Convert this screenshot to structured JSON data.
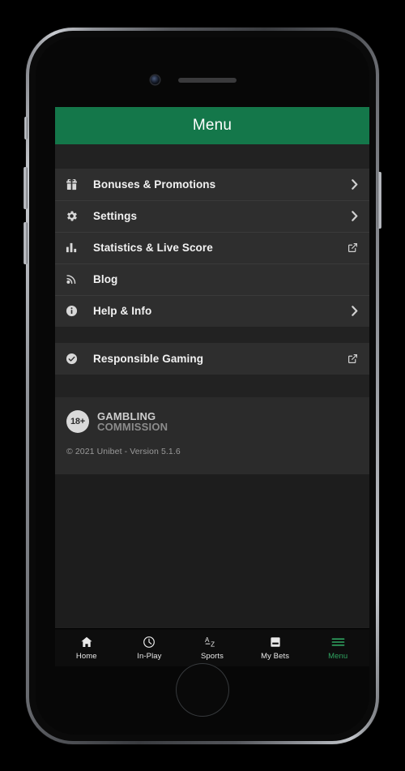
{
  "app": {
    "header_title": "Menu"
  },
  "menu": {
    "groups": [
      {
        "items": [
          {
            "label": "Bonuses & Promotions",
            "icon": "gift-icon",
            "affordance": "chevron-right-icon"
          },
          {
            "label": "Settings",
            "icon": "gear-icon",
            "affordance": "chevron-right-icon"
          },
          {
            "label": "Statistics & Live Score",
            "icon": "bar-chart-icon",
            "affordance": "external-link-icon"
          },
          {
            "label": "Blog",
            "icon": "rss-icon",
            "affordance": "none"
          },
          {
            "label": "Help & Info",
            "icon": "info-circle-icon",
            "affordance": "chevron-right-icon"
          }
        ]
      },
      {
        "items": [
          {
            "label": "Responsible Gaming",
            "icon": "clock-check-icon",
            "affordance": "external-link-icon"
          }
        ]
      }
    ]
  },
  "footer": {
    "age_badge": "18+",
    "regulator_line1": "GAMBLING",
    "regulator_line2": "COMMISSION",
    "copyright": "© 2021 Unibet - Version 5.1.6"
  },
  "bottom_nav": {
    "items": [
      {
        "label": "Home",
        "icon": "home-icon",
        "active": false
      },
      {
        "label": "In-Play",
        "icon": "clock-icon",
        "active": false
      },
      {
        "label": "Sports",
        "icon": "az-sort-icon",
        "active": false
      },
      {
        "label": "My Bets",
        "icon": "bet-slip-icon",
        "active": false
      },
      {
        "label": "Menu",
        "icon": "hamburger-icon",
        "active": true
      }
    ]
  },
  "theme": {
    "brand_green": "#14774a",
    "active_green": "#2fa360",
    "screen_bg": "#1d1d1d",
    "row_bg": "#2e2e2e",
    "nav_bg": "#0d0d0d"
  }
}
